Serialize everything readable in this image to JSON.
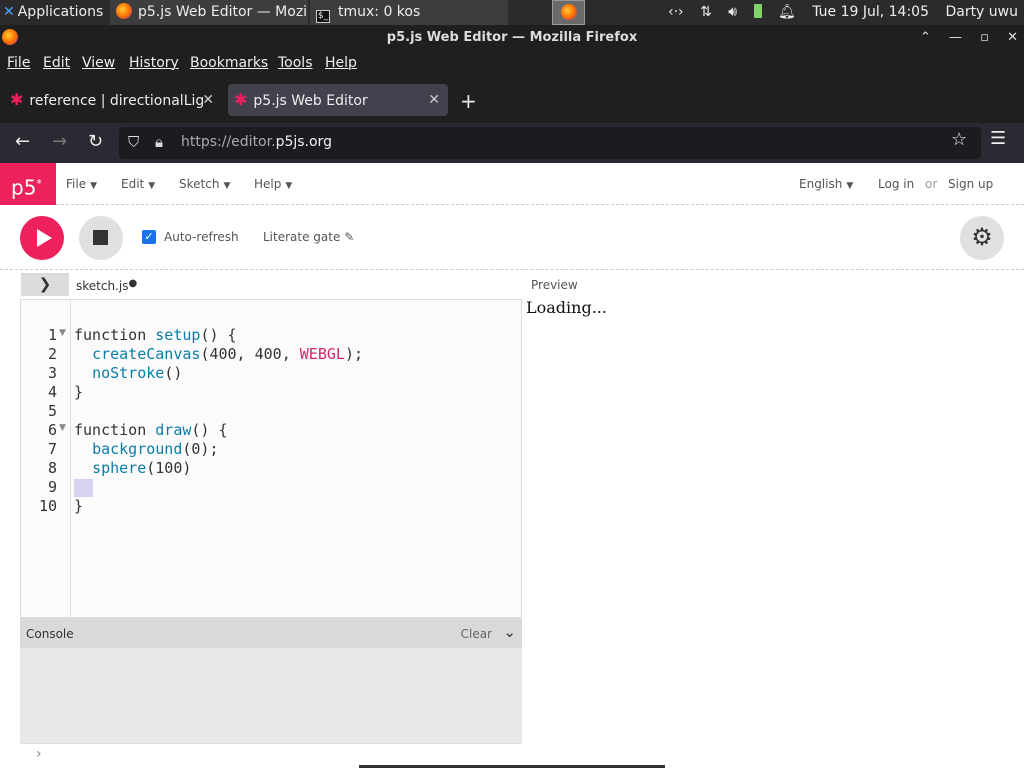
{
  "taskbar": {
    "applications": "Applications",
    "firefox_task": "p5.js Web Editor — Mozi...",
    "tmux_task": "tmux: 0 kos",
    "datetime": "Tue 19 Jul, 14:05",
    "user": "Darty uwu"
  },
  "window": {
    "title": "p5.js Web Editor — Mozilla Firefox"
  },
  "menubar": {
    "items": [
      "File",
      "Edit",
      "View",
      "History",
      "Bookmarks",
      "Tools",
      "Help"
    ]
  },
  "tabs": [
    {
      "label": "reference | directionalLig"
    },
    {
      "label": "p5.js Web Editor"
    }
  ],
  "address": {
    "url_prefix": "https://editor.",
    "url_domain": "p5js.org"
  },
  "p5header": {
    "logo": "p5",
    "menus": [
      "File",
      "Edit",
      "Sketch",
      "Help"
    ],
    "language": "English",
    "login": "Log in",
    "or": "or",
    "signup": "Sign up"
  },
  "toolbar": {
    "autorefresh_label": "Auto-refresh",
    "autorefresh_checked": true,
    "sketch_name": "Literate gate"
  },
  "editor": {
    "file_name": "sketch.js",
    "line_numbers": [
      "1",
      "2",
      "3",
      "4",
      "5",
      "6",
      "7",
      "8",
      "9",
      "10"
    ],
    "lines": [
      "function setup() {",
      "  createCanvas(400, 400, WEBGL);",
      "  noStroke()",
      "}",
      "",
      "function draw() {",
      "  background(0);",
      "  sphere(100)",
      "",
      "}"
    ]
  },
  "console": {
    "title": "Console",
    "clear": "Clear"
  },
  "preview": {
    "label": "Preview",
    "loading": "Loading..."
  },
  "colors": {
    "brand": "#ed225d",
    "keyword_fn": "#0b7ca9",
    "constant": "#d3266e"
  }
}
